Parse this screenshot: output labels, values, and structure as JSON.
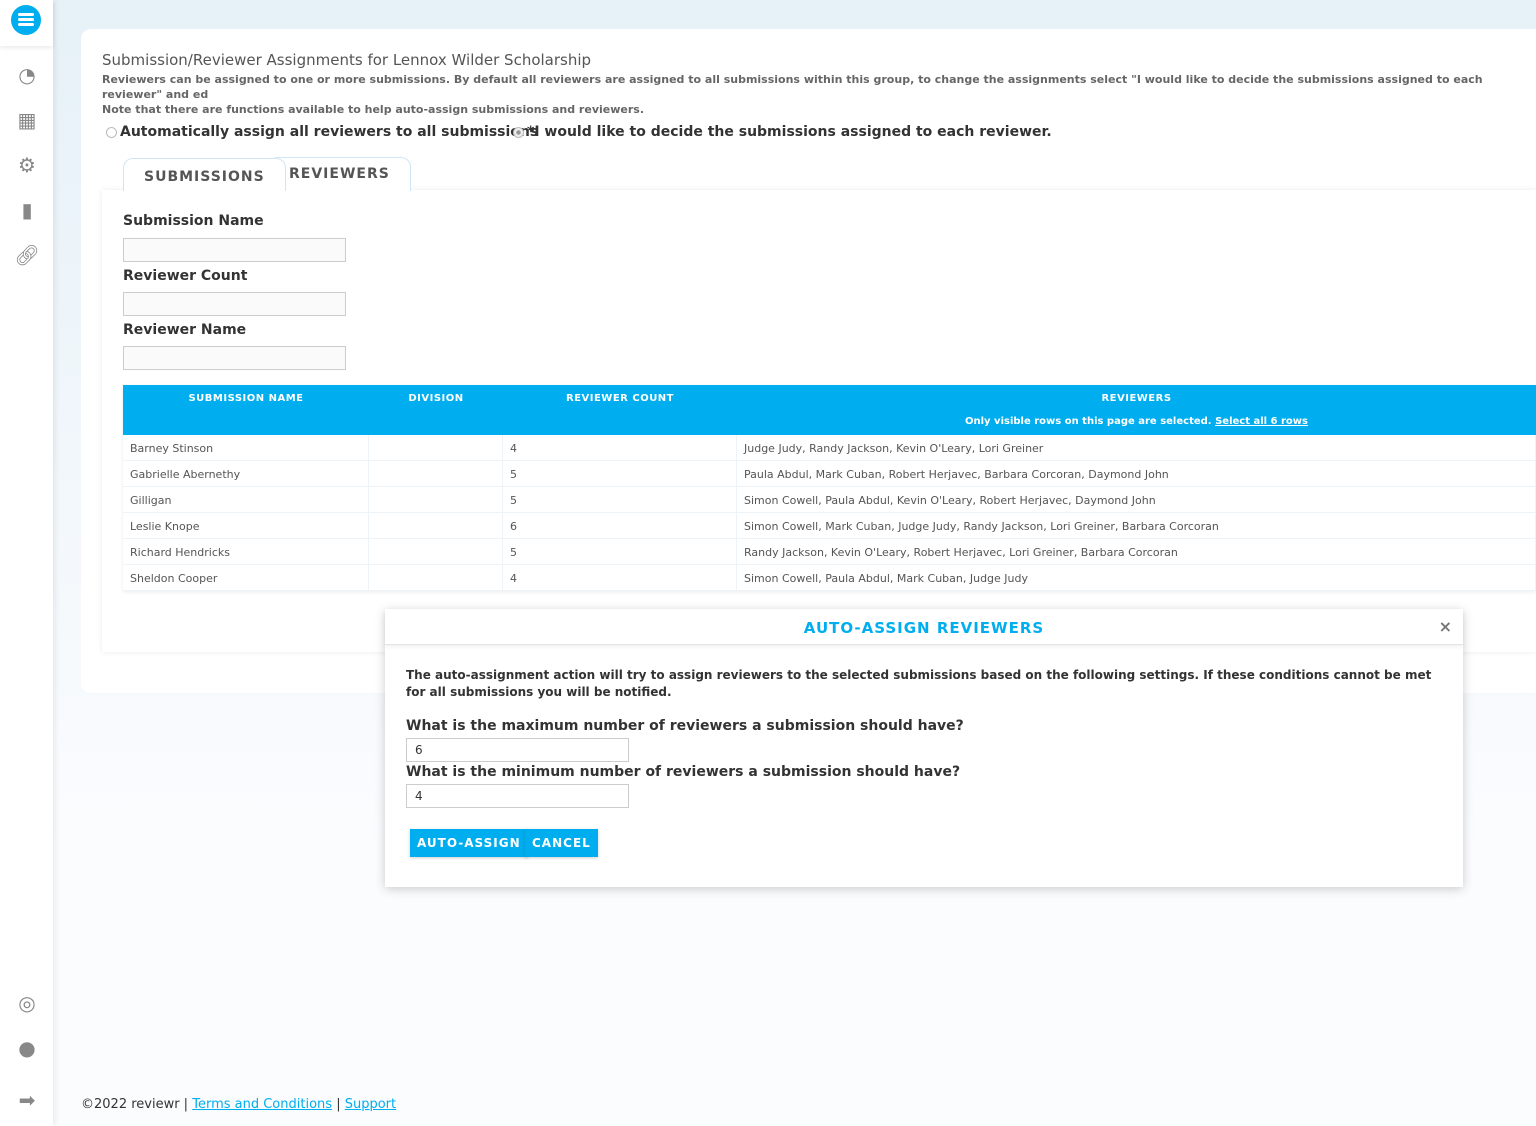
{
  "sidebar": {
    "icons": [
      "logo-icon",
      "dashboard-icon",
      "calendar-icon",
      "gear-icon",
      "clipboard-icon",
      "link-icon",
      "support-icon",
      "user-icon",
      "logout-icon"
    ]
  },
  "page": {
    "title": "Submission/Reviewer Assignments for Lennox Wilder Scholarship",
    "desc1": "Reviewers can be assigned to one or more submissions. By default all reviewers are assigned to all submissions within this group, to change the assignments select \"I would like to decide the submissions assigned to each reviewer\" and ed",
    "desc2": "Note that there are functions available to help auto-assign submissions and reviewers.",
    "radio_auto": "Automatically assign all reviewers to all submissions",
    "radio_manual": "*I would like to decide the submissions assigned to each reviewer.",
    "radio_selected": "manual"
  },
  "tabs": [
    {
      "label": "SUBMISSIONS",
      "active": true
    },
    {
      "label": "REVIEWERS",
      "active": false
    }
  ],
  "filters": [
    {
      "label": "Submission Name",
      "value": ""
    },
    {
      "label": "Reviewer Count",
      "value": ""
    },
    {
      "label": "Reviewer Name",
      "value": ""
    }
  ],
  "table": {
    "headers": [
      "SUBMISSION NAME",
      "DIVISION",
      "REVIEWER COUNT",
      "REVIEWERS"
    ],
    "selection_note": "Only visible rows on this page are selected.",
    "select_all": "Select all 6 rows",
    "rows": [
      [
        "Barney Stinson",
        "",
        "4",
        "Judge Judy, Randy Jackson, Kevin O'Leary, Lori Greiner"
      ],
      [
        "Gabrielle Abernethy",
        "",
        "5",
        "Paula Abdul, Mark Cuban, Robert Herjavec, Barbara Corcoran, Daymond John"
      ],
      [
        "Gilligan",
        "",
        "5",
        "Simon Cowell, Paula Abdul, Kevin O'Leary, Robert Herjavec, Daymond John"
      ],
      [
        "Leslie Knope",
        "",
        "6",
        "Simon Cowell, Mark Cuban, Judge Judy, Randy Jackson, Lori Greiner, Barbara Corcoran"
      ],
      [
        "Richard Hendricks",
        "",
        "5",
        "Randy Jackson, Kevin O'Leary, Robert Herjavec, Lori Greiner, Barbara Corcoran"
      ],
      [
        "Sheldon Cooper",
        "",
        "4",
        "Simon Cowell, Paula Abdul, Mark Cuban, Judge Judy"
      ]
    ]
  },
  "modal": {
    "title": "AUTO-ASSIGN REVIEWERS",
    "close": "×",
    "text": "The auto-assignment action will try to assign reviewers to the selected submissions based on the following settings. If these conditions cannot be met for all submissions you will be notified.",
    "max_label": "What is the maximum number of reviewers a submission should have?",
    "max_value": "6",
    "min_label": "What is the minimum number of reviewers a submission should have?",
    "min_value": "4",
    "auto_assign": "AUTO-ASSIGN",
    "cancel": "CANCEL"
  },
  "footer": {
    "copyright": "©2022 reviewr |",
    "terms": "Terms and Conditions",
    "sep": "|",
    "support": "Support"
  },
  "colors": {
    "accent": "#00aeef"
  }
}
